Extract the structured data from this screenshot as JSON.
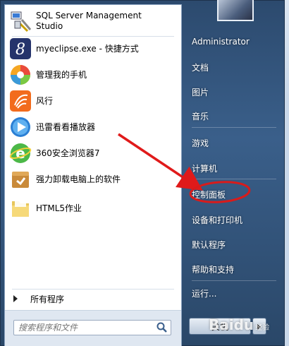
{
  "left_panel": {
    "programs": [
      {
        "label_line1": "SQL Server Management",
        "label_line2": "Studio",
        "icon": "sql-server-icon"
      },
      {
        "label_line1": "myeclipse.exe - 快捷方式",
        "icon": "myeclipse-icon"
      },
      {
        "label_line1": "管理我的手机",
        "icon": "phone-manager-icon"
      },
      {
        "label_line1": "风行",
        "icon": "funshion-icon"
      },
      {
        "label_line1": "迅雷看看播放器",
        "icon": "xunlei-player-icon"
      },
      {
        "label_line1": "360安全浏览器7",
        "icon": "browser-360-icon"
      },
      {
        "label_line1": "强力卸载电脑上的软件",
        "icon": "uninstaller-icon"
      },
      {
        "label_line1": "HTML5作业",
        "icon": "folder-icon"
      }
    ],
    "all_programs": "所有程序",
    "search_placeholder": "搜索程序和文件"
  },
  "right_panel": {
    "user": "Administrator",
    "items": [
      "文档",
      "图片",
      "音乐",
      "游戏",
      "计算机",
      "控制面板",
      "设备和打印机",
      "默认程序",
      "帮助和支持",
      "运行..."
    ],
    "shutdown": "关机"
  },
  "watermark": {
    "text": "Baidu",
    "sub": "经验"
  },
  "colors": {
    "arrow": "#e01a1a",
    "highlight": "#d81b1b"
  }
}
